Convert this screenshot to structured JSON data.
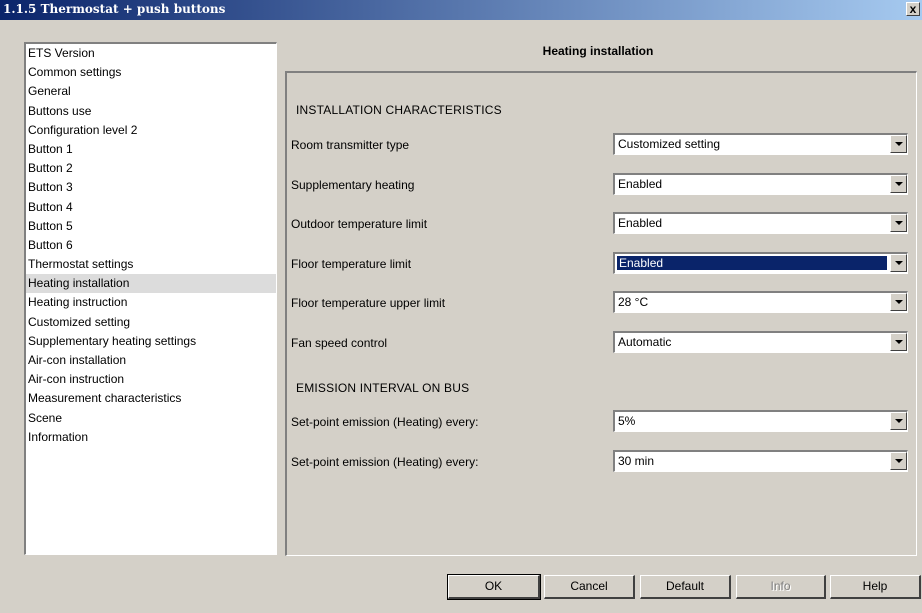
{
  "window": {
    "title": "1.1.5 Thermostat + push buttons",
    "close_label": "x"
  },
  "sidebar": {
    "items": [
      {
        "label": "ETS Version"
      },
      {
        "label": "Common settings"
      },
      {
        "label": "General"
      },
      {
        "label": "Buttons use"
      },
      {
        "label": "Configuration level 2"
      },
      {
        "label": "Button 1"
      },
      {
        "label": "Button 2"
      },
      {
        "label": "Button 3"
      },
      {
        "label": "Button 4"
      },
      {
        "label": "Button 5"
      },
      {
        "label": "Button 6"
      },
      {
        "label": "Thermostat settings"
      },
      {
        "label": "Heating installation",
        "selected": true
      },
      {
        "label": "Heating instruction"
      },
      {
        "label": "Customized setting"
      },
      {
        "label": "Supplementary heating settings"
      },
      {
        "label": "Air-con installation"
      },
      {
        "label": "Air-con instruction"
      },
      {
        "label": "Measurement characteristics"
      },
      {
        "label": "Scene"
      },
      {
        "label": "Information"
      }
    ]
  },
  "main": {
    "title": "Heating installation",
    "installation_heading": "INSTALLATION CHARACTERISTICS",
    "emission_heading": "EMISSION INTERVAL ON BUS",
    "params": [
      {
        "label": "Room transmitter type",
        "value": "Customized setting"
      },
      {
        "label": "Supplementary heating",
        "value": "Enabled"
      },
      {
        "label": "Outdoor temperature limit",
        "value": "Enabled"
      },
      {
        "label": "Floor temperature limit",
        "value": "Enabled",
        "focused": true
      },
      {
        "label": "Floor temperature upper limit",
        "value": "28 °C"
      },
      {
        "label": "Fan speed control",
        "value": "Automatic"
      },
      {
        "label": "Set-point emission (Heating) every:",
        "value": "5%"
      },
      {
        "label": "Set-point emission (Heating) every:",
        "value": "30 min"
      }
    ]
  },
  "buttons": {
    "ok": "OK",
    "cancel": "Cancel",
    "default": "Default",
    "info": "Info",
    "help": "Help"
  },
  "colors": {
    "titlebar_start": "#0a246a",
    "titlebar_end": "#a6caf0",
    "selection": "#0a246a",
    "face": "#d4d0c8"
  }
}
